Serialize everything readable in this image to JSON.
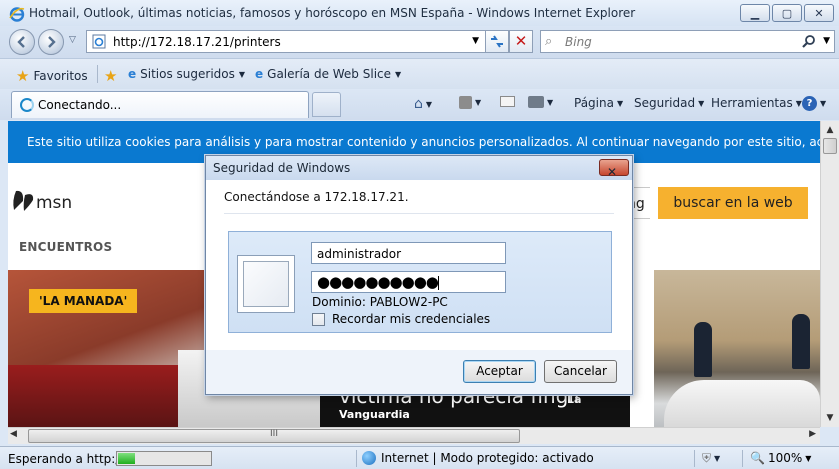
{
  "window": {
    "title": "Hotmail, Outlook, últimas noticias, famosos y horóscopo en MSN España - Windows Internet Explorer"
  },
  "address_bar": {
    "url": "http://172.18.17.21/printers"
  },
  "search_box": {
    "placeholder": "Bing"
  },
  "favorites_bar": {
    "favorites_label": "Favoritos",
    "items": [
      {
        "label": "Sitios sugeridos",
        "icon": "suggested-sites-icon"
      },
      {
        "label": "Galería de Web Slice",
        "icon": "web-slice-icon"
      }
    ]
  },
  "tab": {
    "label": "Conectando..."
  },
  "command_bar": {
    "page_label": "Página",
    "security_label": "Seguridad",
    "tools_label": "Herramientas"
  },
  "page": {
    "cookie_notice": "Este sitio utiliza cookies para análisis y para mostrar contenido y anuncios personalizados. Al continuar navegando por este sitio, aceptas este uso.",
    "logo_text": "msn",
    "search_tail": "ng",
    "search_button": "buscar en la web",
    "section_heading": "ENCUENTROS",
    "tag": "'LA MANADA'",
    "headline": "víctima no parecía fingir",
    "headline_suffix": "La",
    "source": "Vanguardia",
    "colors": {
      "cookie_bg": "#0a79d0",
      "accent": "#f6b12f"
    }
  },
  "dialog": {
    "title": "Seguridad de Windows",
    "message": "Conectándose a 172.18.17.21.",
    "username_value": "administrador",
    "password_value": "●●●●●●●●●●",
    "domain_text": "Dominio: PABLOW2-PC",
    "remember_label": "Recordar mis credenciales",
    "remember_checked": false,
    "ok_label": "Aceptar",
    "cancel_label": "Cancelar"
  },
  "status_bar": {
    "status_text": "Esperando a http://:",
    "progress_fraction": 0.18,
    "zone_text": "Internet | Modo protegido: activado",
    "zoom_text": "100%"
  },
  "scrollbar": {
    "h_grip": "III"
  }
}
